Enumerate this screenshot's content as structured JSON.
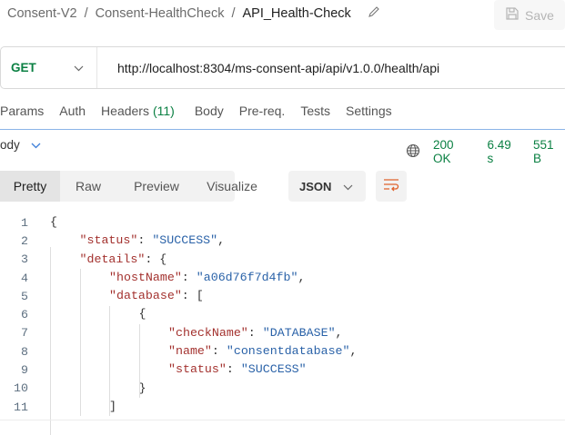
{
  "breadcrumb": {
    "items": [
      "Consent-V2",
      "Consent-HealthCheck"
    ],
    "current": "API_Health-Check",
    "separator": "/"
  },
  "save_label": "Save",
  "request": {
    "method": "GET",
    "url": "http://localhost:8304/ms-consent-api/api/v1.0.0/health/api"
  },
  "tabs": {
    "params": "Params",
    "auth": "Auth",
    "headers": "Headers",
    "headers_count": "(11)",
    "body": "Body",
    "prereq": "Pre-req.",
    "tests": "Tests",
    "settings": "Settings"
  },
  "response": {
    "section": "ody",
    "status": "200 OK",
    "time": "6.49 s",
    "size": "551 B"
  },
  "view_modes": [
    "Pretty",
    "Raw",
    "Preview",
    "Visualize"
  ],
  "format": "JSON",
  "colors": {
    "accent_green": "#0b8043",
    "key": "#a3312e",
    "string": "#2a62a8",
    "wrap_icon": "#e0622c"
  },
  "code_lines": [
    {
      "n": "1",
      "indent": 0,
      "tokens": [
        [
          "p",
          "{"
        ]
      ]
    },
    {
      "n": "2",
      "indent": 1,
      "tokens": [
        [
          "k",
          "\"status\""
        ],
        [
          "p",
          ": "
        ],
        [
          "s",
          "\"SUCCESS\""
        ],
        [
          "p",
          ","
        ]
      ]
    },
    {
      "n": "3",
      "indent": 1,
      "tokens": [
        [
          "k",
          "\"details\""
        ],
        [
          "p",
          ": {"
        ]
      ]
    },
    {
      "n": "4",
      "indent": 2,
      "tokens": [
        [
          "k",
          "\"hostName\""
        ],
        [
          "p",
          ": "
        ],
        [
          "s",
          "\"a06d76f7d4fb\""
        ],
        [
          "p",
          ","
        ]
      ]
    },
    {
      "n": "5",
      "indent": 2,
      "tokens": [
        [
          "k",
          "\"database\""
        ],
        [
          "p",
          ": ["
        ]
      ]
    },
    {
      "n": "6",
      "indent": 3,
      "tokens": [
        [
          "p",
          "{"
        ]
      ]
    },
    {
      "n": "7",
      "indent": 4,
      "tokens": [
        [
          "k",
          "\"checkName\""
        ],
        [
          "p",
          ": "
        ],
        [
          "s",
          "\"DATABASE\""
        ],
        [
          "p",
          ","
        ]
      ]
    },
    {
      "n": "8",
      "indent": 4,
      "tokens": [
        [
          "k",
          "\"name\""
        ],
        [
          "p",
          ": "
        ],
        [
          "s",
          "\"consentdatabase\""
        ],
        [
          "p",
          ","
        ]
      ]
    },
    {
      "n": "9",
      "indent": 4,
      "tokens": [
        [
          "k",
          "\"status\""
        ],
        [
          "p",
          ": "
        ],
        [
          "s",
          "\"SUCCESS\""
        ]
      ]
    },
    {
      "n": "10",
      "indent": 3,
      "tokens": [
        [
          "p",
          "}"
        ]
      ]
    },
    {
      "n": "11",
      "indent": 2,
      "tokens": [
        [
          "p",
          "]"
        ]
      ]
    }
  ]
}
